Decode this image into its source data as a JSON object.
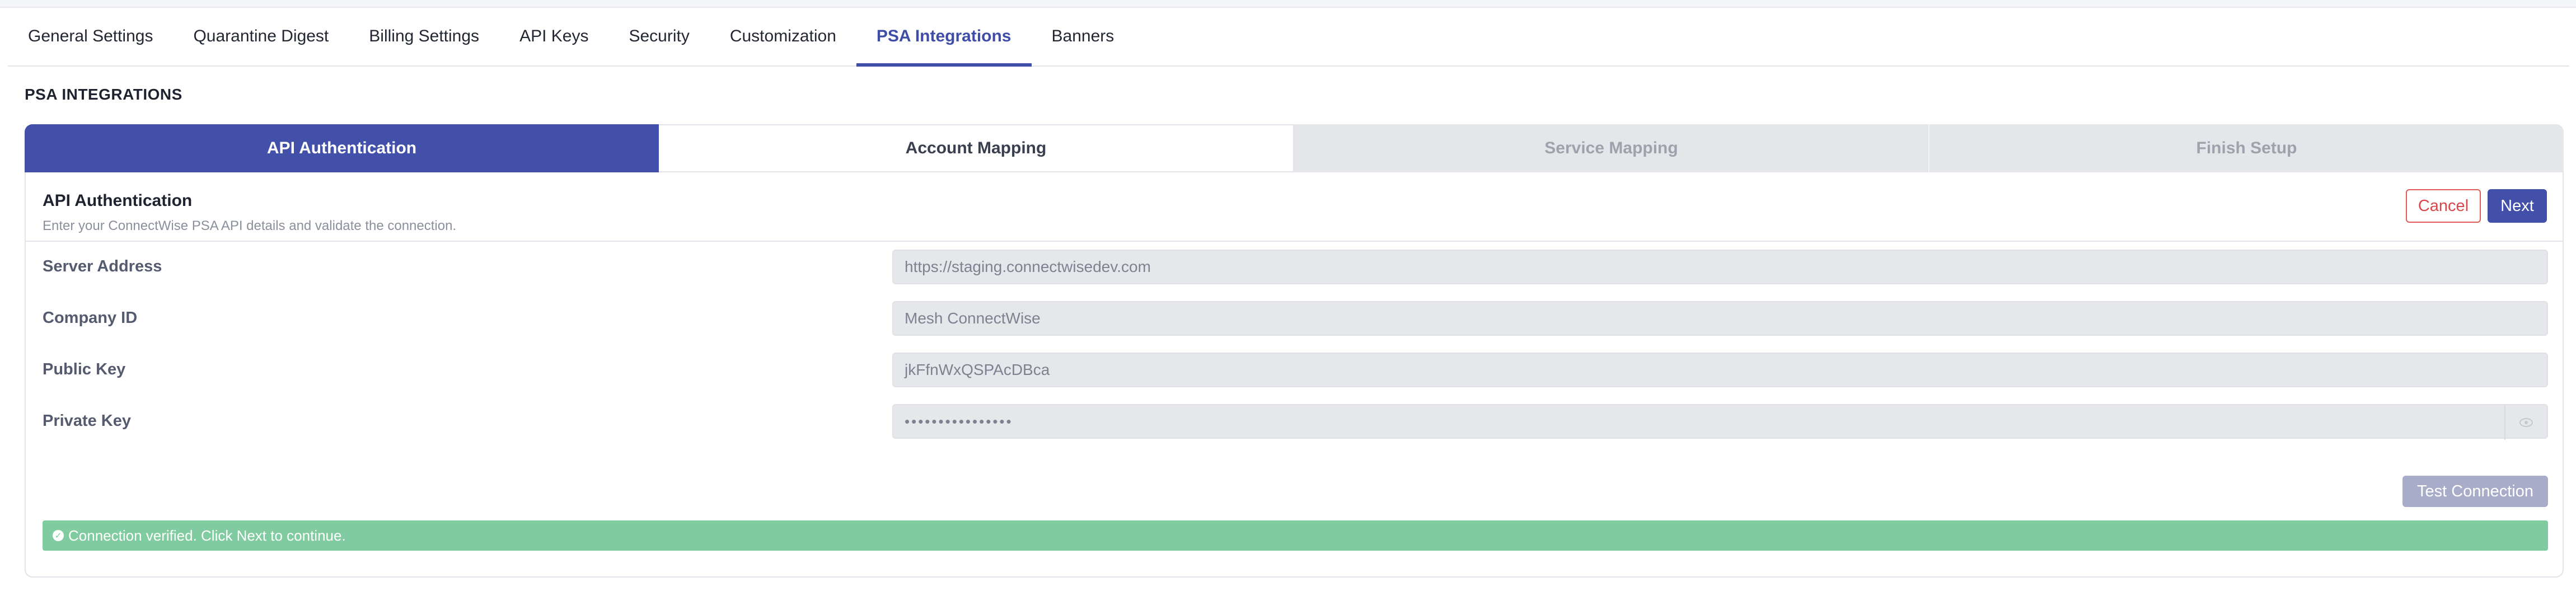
{
  "tabs": [
    {
      "label": "General Settings",
      "active": false
    },
    {
      "label": "Quarantine Digest",
      "active": false
    },
    {
      "label": "Billing Settings",
      "active": false
    },
    {
      "label": "API Keys",
      "active": false
    },
    {
      "label": "Security",
      "active": false
    },
    {
      "label": "Customization",
      "active": false
    },
    {
      "label": "PSA Integrations",
      "active": true
    },
    {
      "label": "Banners",
      "active": false
    }
  ],
  "section_title": "PSA INTEGRATIONS",
  "steps": [
    {
      "label": "API Authentication",
      "state": "current"
    },
    {
      "label": "Account Mapping",
      "state": "next"
    },
    {
      "label": "Service Mapping",
      "state": "disabled"
    },
    {
      "label": "Finish Setup",
      "state": "disabled"
    }
  ],
  "card": {
    "title": "API Authentication",
    "subtitle": "Enter your ConnectWise PSA API details and validate the connection.",
    "cancel_label": "Cancel",
    "next_label": "Next"
  },
  "fields": [
    {
      "label": "Server Address",
      "value": "https://staging.connectwisedev.com"
    },
    {
      "label": "Company ID",
      "value": "Mesh ConnectWise"
    },
    {
      "label": "Public Key",
      "value": "jkFfnWxQSPAcDBca"
    },
    {
      "label": "Private Key",
      "value": "••••••••••••••••"
    }
  ],
  "test_connection_label": "Test Connection",
  "status_message": "Connection verified. Click Next to continue.",
  "colors": {
    "accent": "#4250a9",
    "success": "#80cba0",
    "danger": "#d9474b",
    "disabled_button": "#a9acc9"
  },
  "icons": {
    "status": "check-circle-icon",
    "password_toggle": "eye-icon"
  }
}
